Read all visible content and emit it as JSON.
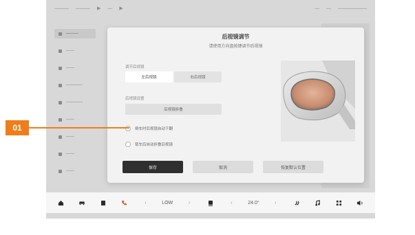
{
  "topbar": {
    "items": [
      "———",
      "———",
      "▶",
      "—",
      "▶"
    ],
    "right_items": [
      "—",
      "—",
      "——————"
    ]
  },
  "sidebar": {
    "items": [
      {
        "label": "———",
        "active": true
      },
      {
        "label": "——",
        "active": false
      },
      {
        "label": "——",
        "active": false
      },
      {
        "label": "————",
        "active": false
      },
      {
        "label": "————",
        "active": false
      },
      {
        "label": "——",
        "active": false
      },
      {
        "label": "——",
        "active": false
      },
      {
        "label": "——",
        "active": false
      },
      {
        "label": "——",
        "active": false
      }
    ]
  },
  "dialog": {
    "title": "后视镜调节",
    "subtitle": "请使用方向盘按键调节后视镜",
    "section1_label": "调节后视镜",
    "seg_left": "左后视镜",
    "seg_right": "右后视镜",
    "section2_label": "后视镜设置",
    "wide_button": "后视镜折叠",
    "check1_label": "倒车时后视镜自动下翻",
    "check2_label": "锁车后自动折叠后视镜",
    "btn_primary": "保存",
    "btn_secondary": "取消",
    "btn_tertiary": "恢复默认位置"
  },
  "bottombar": {
    "fan_label": "LOW",
    "temp_label": "24.0°",
    "left_chev": "‹",
    "right_chev": "›"
  },
  "callout": {
    "label": "01",
    "color": "#ef7d1a"
  },
  "icons": {
    "home": "home-icon",
    "car": "car-icon",
    "seat": "seat-icon",
    "phone": "phone-icon",
    "fan": "fan-icon",
    "seat_heat": "seat-heat-icon",
    "music": "music-icon",
    "apps": "apps-icon",
    "volume": "volume-icon"
  }
}
